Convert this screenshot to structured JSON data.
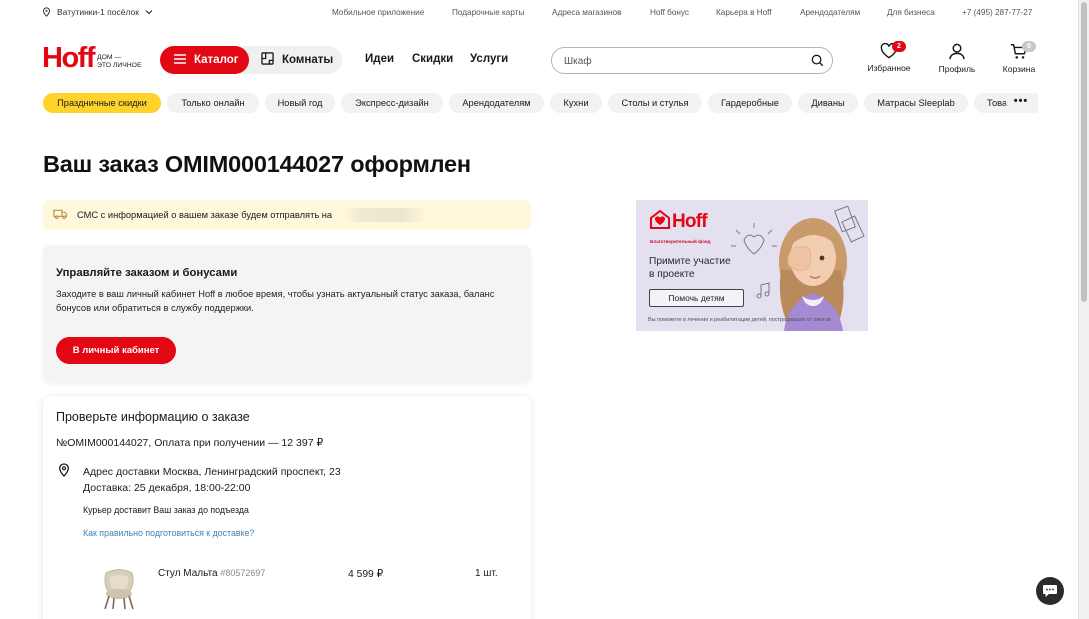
{
  "topbar": {
    "location": "Ватутинки-1 посёлок",
    "links": [
      "Мобильное приложение",
      "Подарочные карты",
      "Адреса магазинов",
      "Hoff бонус",
      "Карьера в Hoff",
      "Арендодателям",
      "Для бизнеса",
      "+7 (495) 287-77-27"
    ]
  },
  "header": {
    "logo_word": "Hoff",
    "logo_tagline": "ДОМ —\nЭТО ЛИЧНОЕ",
    "catalog_label": "Каталог",
    "rooms_label": "Комнаты",
    "nav": [
      "Идеи",
      "Скидки",
      "Услуги"
    ],
    "search_placeholder": "Шкаф",
    "favorites_label": "Избранное",
    "favorites_count": "2",
    "profile_label": "Профиль",
    "cart_label": "Корзина",
    "cart_count": "0"
  },
  "chips": [
    "Праздничные скидки",
    "Только онлайн",
    "Новый год",
    "Экспресс-дизайн",
    "Арендодателям",
    "Кухни",
    "Столы и стулья",
    "Гардеробные",
    "Диваны",
    "Матрасы Sleeplab",
    "Товары"
  ],
  "main": {
    "title": "Ваш заказ OMIM000144027 оформлен",
    "sms_text": "СМС с информацией о вашем заказе будем отправлять на",
    "manage": {
      "title": "Управляйте заказом и бонусами",
      "description": "Заходите в ваш личный кабинет Hoff в любое время, чтобы узнать актуальный статус заказа, баланс бонусов или обратиться в службу поддержки.",
      "button": "В личный кабинет"
    },
    "check": {
      "title": "Проверьте информацию о заказе",
      "order_line": "№OMIM000144027, Оплата при получении — 12 397 ₽",
      "address_label": "Адрес доставки",
      "address_value": "Москва, Ленинградский проспект, 23",
      "delivery_label": "Доставка:",
      "delivery_value": "25 декабря, 18:00-22:00",
      "courier_note": "Курьер доставит Ваш заказ до подъезда",
      "howto_link": "Как правильно подготовиться к доставке?",
      "item": {
        "name": "Стул Мальта",
        "sku": "#80572697",
        "price": "4 599 ₽",
        "qty": "1 шт."
      }
    }
  },
  "banner": {
    "logo_word": "Hoff",
    "fund_label": "Благотворительный фонд",
    "text": "Примите участие\nв проекте",
    "button": "Помочь детям",
    "footer": "Вы поможете в лечении и реабилитации детей, пострадавших от ожогов"
  },
  "colors": {
    "brand_red": "#e30613",
    "promo_yellow": "#ffd32a",
    "info_bg": "#fff8dc",
    "link_blue": "#3b82b6"
  }
}
